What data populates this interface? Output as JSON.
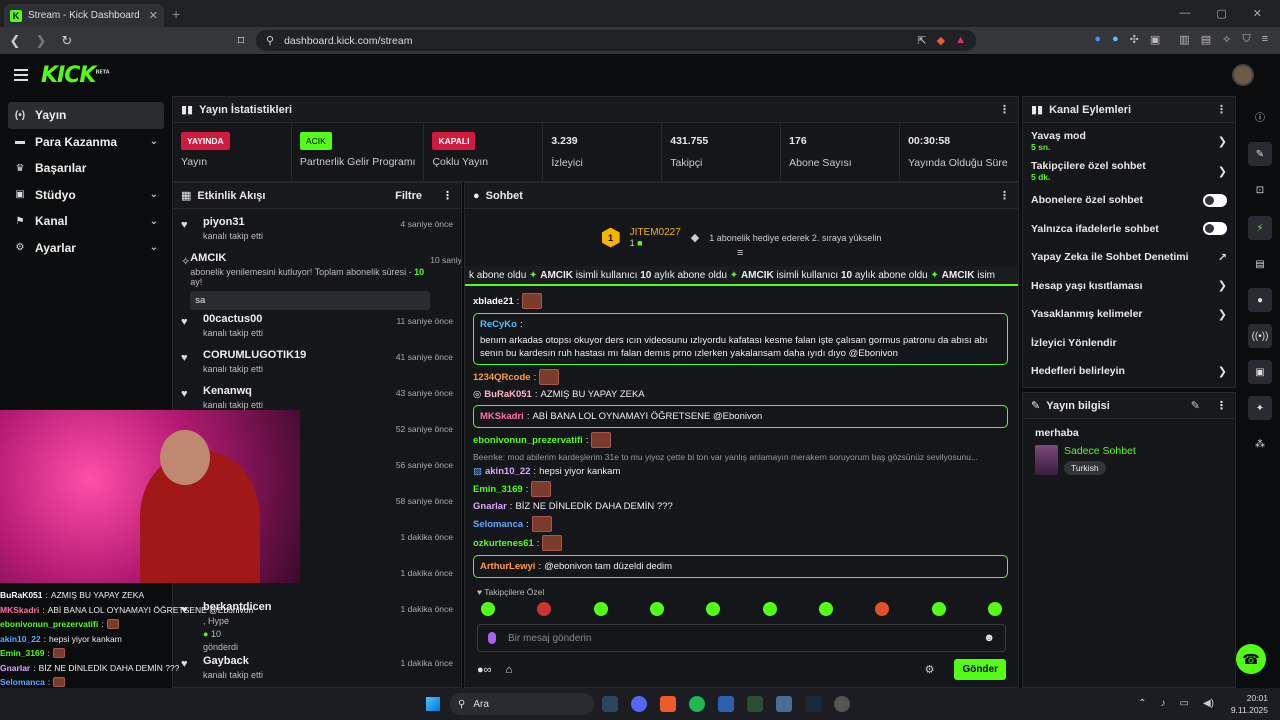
{
  "browser": {
    "tab_title": "Stream - Kick Dashboard",
    "url": "dashboard.kick.com/stream",
    "favicon": "K",
    "newtab": "+",
    "close": "✕",
    "back": "❮",
    "forward": "❯",
    "reload": "↻"
  },
  "header": {
    "logo": "KICK",
    "logo_sup": "BETA"
  },
  "nav": [
    {
      "label": "Yayın",
      "icon": "broadcast-icon",
      "expand": false
    },
    {
      "label": "Para Kazanma",
      "icon": "money-icon",
      "expand": true
    },
    {
      "label": "Başarılar",
      "icon": "trophy-icon",
      "expand": false
    },
    {
      "label": "Stüdyo",
      "icon": "studio-icon",
      "expand": true
    },
    {
      "label": "Kanal",
      "icon": "channel-icon",
      "expand": true
    },
    {
      "label": "Ayarlar",
      "icon": "settings-icon",
      "expand": true
    }
  ],
  "stats": {
    "title": "Yayın İstatistikleri",
    "items": [
      {
        "badge": "YAYINDA",
        "label": "Yayın"
      },
      {
        "badge": "ACIK",
        "label": "Partnerlik Gelir Programı"
      },
      {
        "badge": "KAPALI",
        "label": "Çoklu Yayın"
      },
      {
        "value": "3.239",
        "label": "İzleyici"
      },
      {
        "value": "431.755",
        "label": "Takipçi"
      },
      {
        "value": "176",
        "label": "Abone Sayısı"
      },
      {
        "value": "00:30:58",
        "label": "Yayında Olduğu Süre"
      }
    ]
  },
  "activity": {
    "title": "Etkinlik Akışı",
    "filter": "Filtre",
    "items": [
      {
        "name": "piyon31",
        "sub": "kanalı takip etti",
        "time": "4 saniye önce"
      },
      {
        "name": "AMCIK",
        "sub": "abonelik yenilemesini kutluyor! Toplam abonelik süresi - ",
        "sub_num": "10",
        "sub_tail": " ay!",
        "time": "10 saniye önce",
        "msg": "sa"
      },
      {
        "name": "00cactus00",
        "sub": "kanalı takip etti",
        "time": "11 saniye önce"
      },
      {
        "name": "CORUMLUGOTIK19",
        "sub": "kanalı takip etti",
        "time": "41 saniye önce"
      },
      {
        "name": "Kenanwq",
        "sub": "kanalı takip etti",
        "time": "43 saniye önce"
      },
      {
        "name": "k",
        "sub": "",
        "time": "52 saniye önce"
      },
      {
        "name": "",
        "sub": "",
        "time": "56 saniye önce"
      },
      {
        "name": "",
        "sub": "",
        "time": "58 saniye önce"
      },
      {
        "name": "",
        "sub": "",
        "time": "1 dakika önce"
      },
      {
        "name": "",
        "sub": "kanalı takip etti",
        "time": "1 dakika önce"
      },
      {
        "name": "berkantdicen",
        "sub": ", Hype",
        "gift": "10",
        "gift_label": "gönderdi",
        "time": "1 dakika önce"
      },
      {
        "name": "Gayback",
        "sub": "kanalı takip etti",
        "time": "1 dakika önce"
      }
    ]
  },
  "chat": {
    "title": "Sohbet",
    "pinned": {
      "name": "JITEM0227",
      "count": "1",
      "rank": "1",
      "msg": "1 abonelik hediye ederek 2. sıraya yükselin"
    },
    "ticker": [
      {
        "pre": "k abone oldu"
      },
      {
        "name": "AMCIK",
        "text": " isimli kullanıcı ",
        "num": "10",
        "tail": " aylık abone oldu"
      },
      {
        "name": "AMCIK",
        "text": " isimli kullanıcı ",
        "num": "10",
        "tail": " aylık abone oldu"
      },
      {
        "name": "AMCIK",
        "text": " isim"
      }
    ],
    "messages": [
      {
        "user": "xblade21",
        "color": "#ffffff",
        "text": "",
        "emote": true
      },
      {
        "user": "ReCyKo",
        "color": "#4cc2ff",
        "text": "benım arkadas otopsı okuyor ders ıcın videosunu ızlıyordu kafatası kesme falan işte çalısan gormus patronu da abısı abı senın bu kardesın ruh hastası mı falan demıs prno ızlerken yakalansam daha ıyıdı dıyo @Ebonivon",
        "hl": true
      },
      {
        "user": "1234QRcode",
        "color": "#ff9d3b",
        "text": "",
        "emote": true
      },
      {
        "user": "BuRaK051",
        "color": "#ffb3c6",
        "text": "AZMIŞ BU YAPAY ZEKA"
      },
      {
        "user": "MKSkadri",
        "color": "#ff6fa5",
        "text": "ABİ BANA LOL OYNAMAYI ÖĞRETSENE @Ebonivon",
        "hl": true
      },
      {
        "user": "ebonivonun_prezervatifi",
        "color": "#53fc18",
        "text": "",
        "emote": true
      },
      {
        "user": "akin10_22",
        "color": "#d9a7ff",
        "text": "hepsi yiyor kankam",
        "reply": "Beerrke: mod abilerim kardeşlerim 31e to mu yiyoz çette bi ton var yanlış anlamayın merakern soruyorum baş gözsünüz sevilyosunu..."
      },
      {
        "user": "Emin_3169",
        "color": "#53fc18",
        "text": "",
        "emote": true
      },
      {
        "user": "Gnarlar",
        "color": "#d9a7ff",
        "text": "BİZ NE DİNLEDİK DAHA DEMİN ???"
      },
      {
        "user": "Selomanca",
        "color": "#5ca7ff",
        "text": "",
        "emote": true
      },
      {
        "user": "ozkurtenes61",
        "color": "#53fc18",
        "text": "",
        "emote": true
      },
      {
        "user": "ArthurLewyi",
        "color": "#ff9d3b",
        "text": "@ebonivon tam düzeldi dedim",
        "hl": true
      }
    ],
    "sub_only": "Takipçilere Özel",
    "placeholder": "Bir mesaj gönderin",
    "send": "Gönder"
  },
  "actions": {
    "title": "Kanal Eylemleri",
    "items": [
      {
        "label": "Yavaş mod",
        "sub": "5 sn.",
        "type": "arrow"
      },
      {
        "label": "Takipçilere özel sohbet",
        "sub": "5 dk.",
        "type": "arrow"
      },
      {
        "label": "Abonelere özel sohbet",
        "type": "toggle",
        "on": false
      },
      {
        "label": "Yalnızca ifadelerle sohbet",
        "type": "toggle",
        "on": false
      },
      {
        "label": "Yapay Zeka ile Sohbet Denetimi",
        "type": "ext"
      },
      {
        "label": "Hesap yaşı kısıtlaması",
        "type": "arrow"
      },
      {
        "label": "Yasaklanmış kelimeler",
        "type": "arrow"
      },
      {
        "label": "İzleyici Yönlendir",
        "type": "none"
      },
      {
        "label": "Hedefleri belirleyin",
        "type": "arrow"
      }
    ]
  },
  "stream_info": {
    "header": "Yayın bilgisi",
    "title": "merhaba",
    "category": "Sadece Sohbet",
    "tag": "Turkish"
  },
  "overlay_chat": [
    {
      "user": "BuRaK051",
      "color": "#ffffff",
      "text": "AZMIŞ BU YAPAY ZEKA"
    },
    {
      "user": "MKSkadri",
      "color": "#ff6fa5",
      "text": "ABİ BANA LOL OYNAMAYI ÖĞRETSENE @Ebonivon"
    },
    {
      "user": "ebonivonun_prezervatifi",
      "color": "#53fc18",
      "text": ""
    },
    {
      "user": "akin10_22",
      "color": "#5ca7ff",
      "text": "hepsi yiyor kankam"
    },
    {
      "user": "Emin_3169",
      "color": "#53fc18",
      "text": ""
    },
    {
      "user": "Gnarlar",
      "color": "#d9a7ff",
      "text": "BİZ NE DİNLEDİK DAHA DEMİN ???"
    },
    {
      "user": "Selomanca",
      "color": "#5ca7ff",
      "text": ""
    },
    {
      "user": "ozkurtenes61",
      "color": "#53fc18",
      "text": ""
    }
  ],
  "taskbar": {
    "search": "Ara",
    "time": "20:01",
    "date": "9.11.2025"
  },
  "colors": {
    "accent": "#53fc18",
    "live": "#d11a3f",
    "bg": "#0b0c0e",
    "panel": "#15161a"
  }
}
